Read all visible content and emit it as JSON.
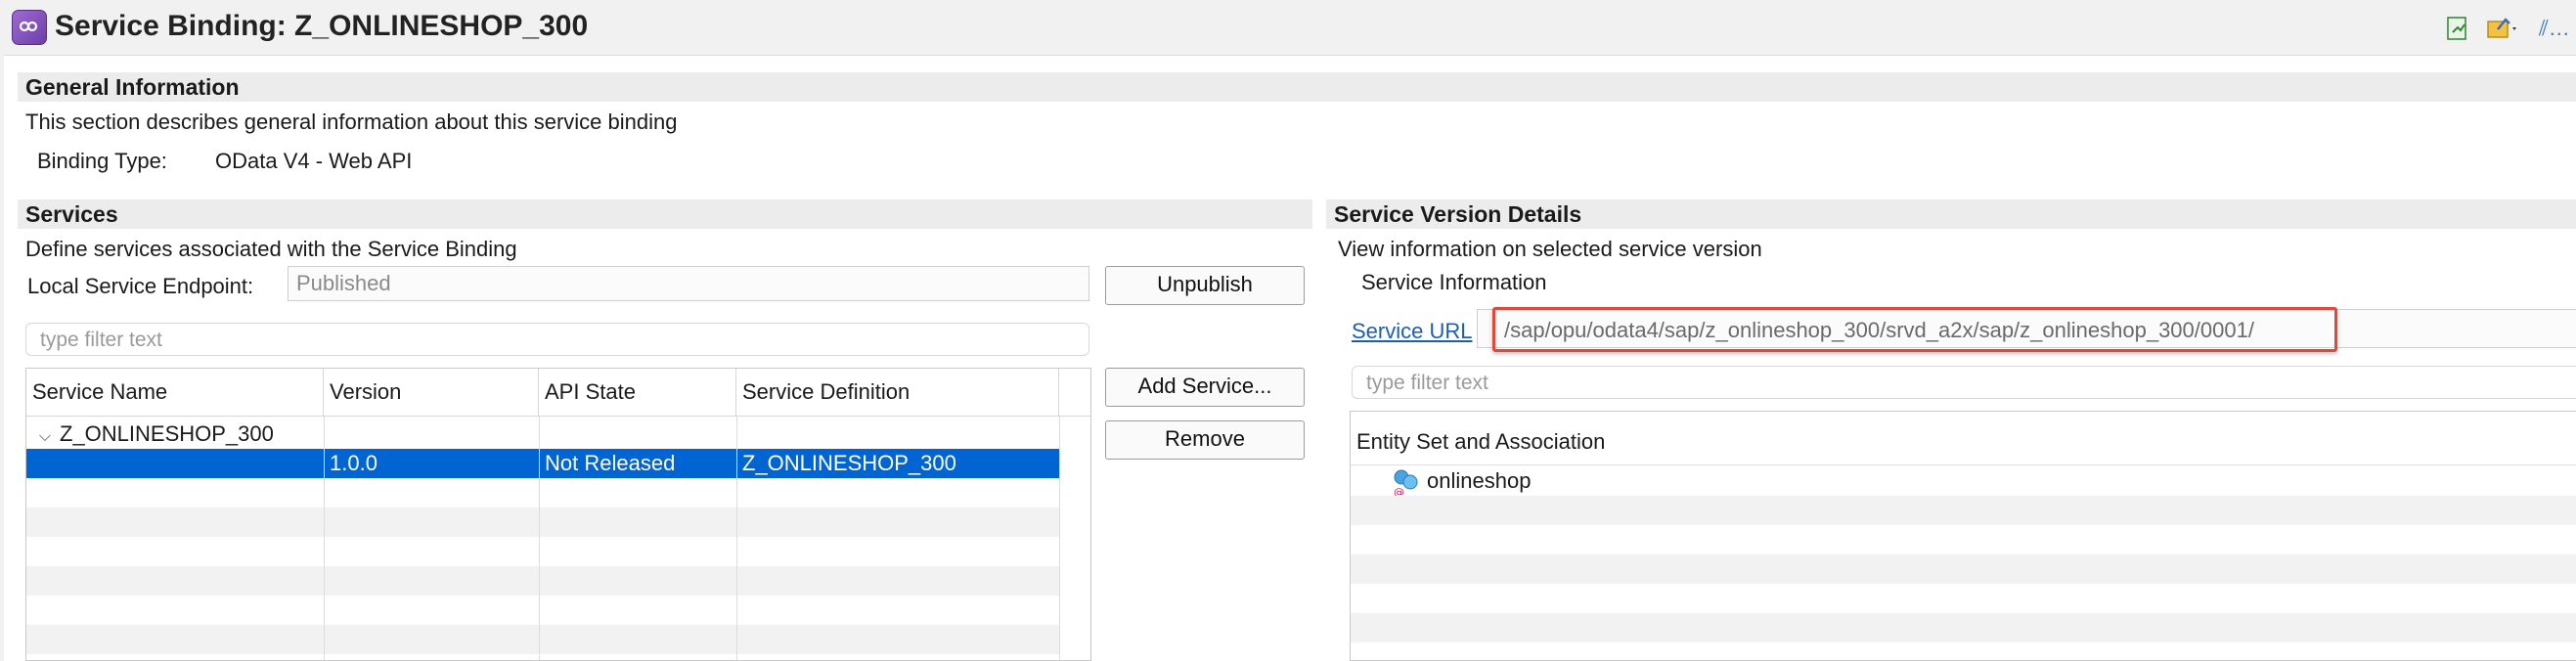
{
  "window": {
    "title": "Service Binding: Z_ONLINESHOP_300"
  },
  "general": {
    "header": "General Information",
    "description": "This section describes general information about this service binding",
    "binding_type_label": "Binding Type:",
    "binding_type_value": "OData V4 - Web API"
  },
  "services": {
    "header": "Services",
    "description": "Define services associated with the Service Binding",
    "endpoint_label": "Local Service Endpoint:",
    "endpoint_value": "Published",
    "filter_placeholder": "type filter text",
    "unpublish_label": "Unpublish",
    "add_service_label": "Add Service...",
    "remove_label": "Remove",
    "columns": [
      "Service Name",
      "Version",
      "API State",
      "Service Definition"
    ],
    "rows": [
      {
        "name": "Z_ONLINESHOP_300",
        "version": "",
        "state": "",
        "definition": "",
        "expanded": true
      },
      {
        "name": "",
        "version": "1.0.0",
        "state": "Not Released",
        "definition": "Z_ONLINESHOP_300",
        "selected": true
      }
    ]
  },
  "version_details": {
    "header": "Service Version Details",
    "description": "View information on selected service version",
    "info_label": "Service Information",
    "service_url_label": "Service URL",
    "service_url_value": "/sap/opu/odata4/sap/z_onlineshop_300/srvd_a2x/sap/z_onlineshop_300/0001/",
    "filter_placeholder": "type filter text",
    "entity_header": "Entity Set and Association",
    "entities": [
      "onlineshop"
    ]
  },
  "colors": {
    "selection": "#0064d2",
    "highlight_box": "#e0493a",
    "link": "#1a5fb4"
  },
  "icons": {
    "app": "service-binding-icon",
    "toolbar": [
      "export-icon",
      "publish-icon",
      "more-icon"
    ],
    "entity": "entity-set-icon"
  }
}
